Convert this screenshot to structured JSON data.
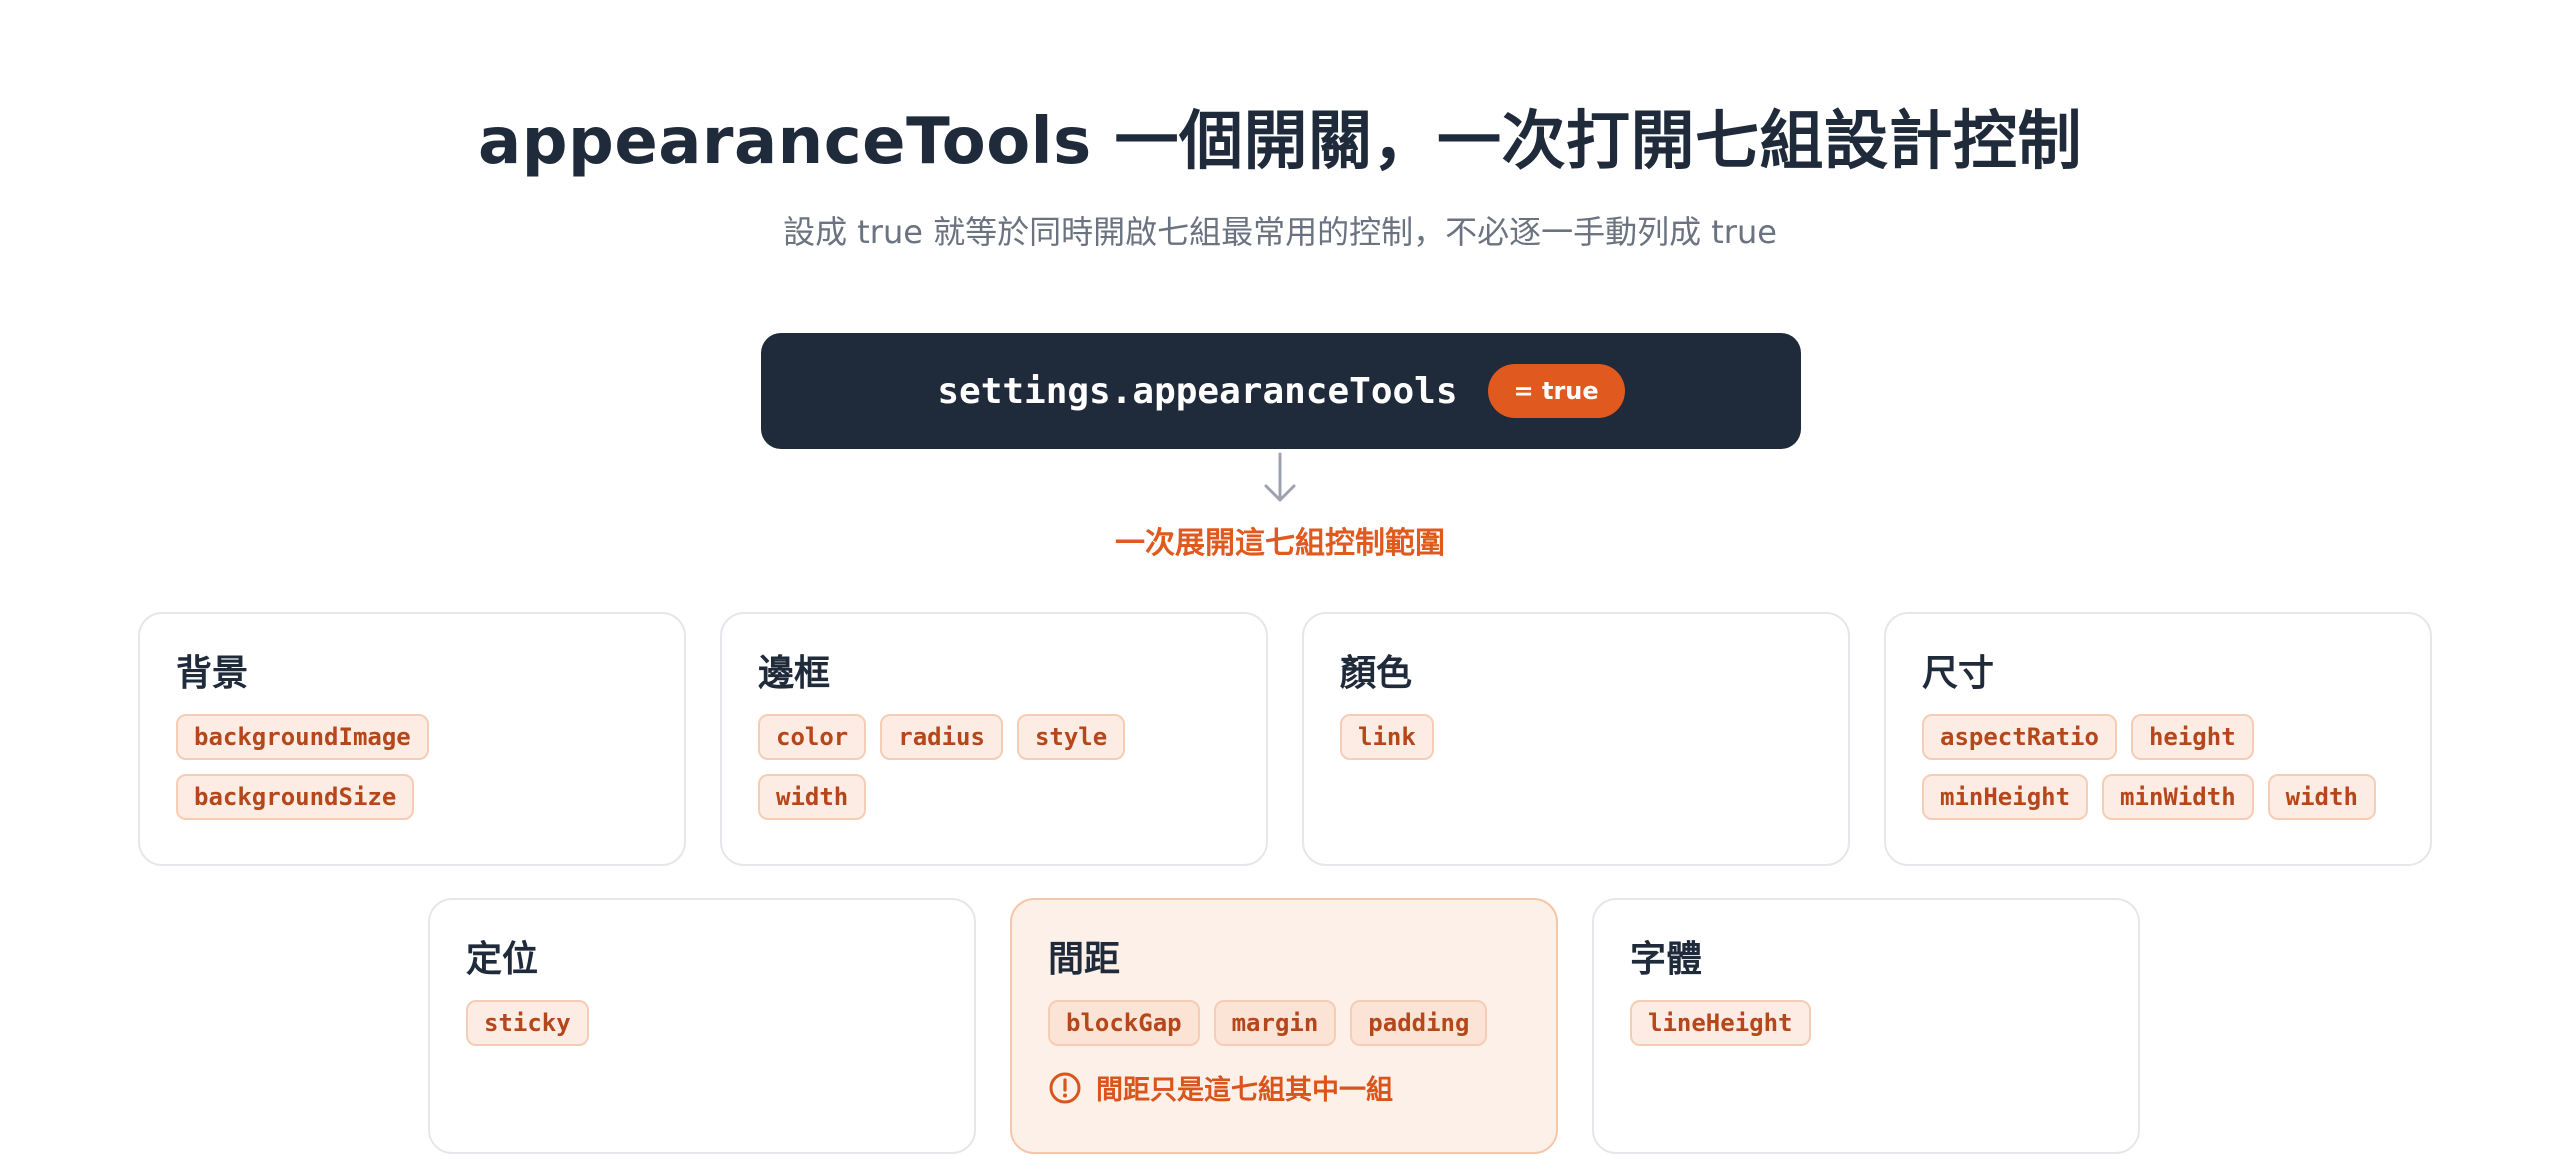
{
  "header": {
    "title": "appearanceTools 一個開關，一次打開七組設計控制",
    "subtitle": "設成 true 就等於同時開啟七組最常用的控制，不必逐一手動列成 true"
  },
  "setting": {
    "code": "settings.appearanceTools",
    "value_pill": "= true"
  },
  "expand_label": "一次展開這七組控制範圍",
  "groups": [
    {
      "title": "背景",
      "tags": [
        "backgroundImage",
        "backgroundSize"
      ]
    },
    {
      "title": "邊框",
      "tags": [
        "color",
        "radius",
        "style",
        "width"
      ]
    },
    {
      "title": "顏色",
      "tags": [
        "link"
      ]
    },
    {
      "title": "尺寸",
      "tags": [
        "aspectRatio",
        "height",
        "minHeight",
        "minWidth",
        "width"
      ]
    },
    {
      "title": "定位",
      "tags": [
        "sticky"
      ]
    },
    {
      "title": "間距",
      "tags": [
        "blockGap",
        "margin",
        "padding"
      ],
      "note": "間距只是這七組其中一組"
    },
    {
      "title": "字體",
      "tags": [
        "lineHeight"
      ]
    }
  ],
  "icons": {
    "arrow": "arrow-down-icon",
    "note": "alert-circle-icon"
  },
  "colors": {
    "accent": "#e0591e",
    "dark": "#1f2a3a",
    "highlight_bg": "#fdf0e8"
  }
}
